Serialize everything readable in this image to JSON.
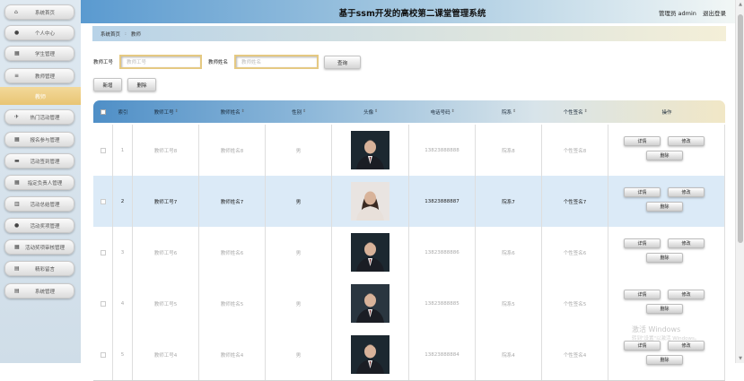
{
  "app": {
    "title": "基于ssm开发的高校第二课堂管理系统"
  },
  "user": {
    "role_name": "管理员 admin",
    "logout": "退出登录"
  },
  "sidebar": {
    "items": [
      {
        "label": "系统首页",
        "icon": "home-icon"
      },
      {
        "label": "个人中心",
        "icon": "person-icon"
      },
      {
        "label": "学生管理",
        "icon": "table-icon"
      },
      {
        "label": "教师管理",
        "icon": "list-icon"
      }
    ],
    "active": "教师",
    "sub_items": [
      {
        "label": "热门活动管理",
        "icon": "plane-icon"
      },
      {
        "label": "报名参与管理",
        "icon": "grid-icon"
      },
      {
        "label": "活动签到管理",
        "icon": "briefcase-icon"
      },
      {
        "label": "指定负责人管理",
        "icon": "grid-icon"
      },
      {
        "label": "活动总结管理",
        "icon": "chart-icon"
      },
      {
        "label": "活动奖项管理",
        "icon": "pin-icon"
      },
      {
        "label": "活动奖项审核管理",
        "icon": "grid-icon"
      },
      {
        "label": "精彩留言",
        "icon": "doc-icon"
      },
      {
        "label": "系统管理",
        "icon": "doc-icon"
      }
    ]
  },
  "breadcrumb": {
    "home": "系统首页",
    "separator": ":",
    "current": "教师"
  },
  "search": {
    "no_label": "教师工号",
    "no_placeholder": "教师工号",
    "name_label": "教师姓名",
    "name_placeholder": "教师姓名",
    "query_button": "查询"
  },
  "actions": {
    "add": "新增",
    "delete": "删除"
  },
  "table": {
    "headers": [
      "索引",
      "教师工号",
      "教师姓名",
      "性别",
      "头像",
      "电话号码",
      "院系",
      "个性签名",
      "操作"
    ],
    "rows": [
      {
        "idx": "1",
        "no": "教师工号8",
        "name": "教师姓名8",
        "gender": "男",
        "phone": "13823888888",
        "dept": "院系8",
        "sign": "个性签名8"
      },
      {
        "idx": "2",
        "no": "教师工号7",
        "name": "教师姓名7",
        "gender": "男",
        "phone": "13823888887",
        "dept": "院系7",
        "sign": "个性签名7"
      },
      {
        "idx": "3",
        "no": "教师工号6",
        "name": "教师姓名6",
        "gender": "男",
        "phone": "13823888886",
        "dept": "院系6",
        "sign": "个性签名6"
      },
      {
        "idx": "4",
        "no": "教师工号5",
        "name": "教师姓名5",
        "gender": "男",
        "phone": "13823888885",
        "dept": "院系5",
        "sign": "个性签名5"
      },
      {
        "idx": "5",
        "no": "教师工号4",
        "name": "教师姓名4",
        "gender": "男",
        "phone": "13823888884",
        "dept": "院系4",
        "sign": "个性签名4"
      }
    ],
    "row_actions": {
      "detail": "详情",
      "edit": "修改",
      "delete": "删除"
    }
  },
  "watermark": {
    "line1": "激活 Windows",
    "line2": "转到\"设置\"以激活 Windows。"
  }
}
